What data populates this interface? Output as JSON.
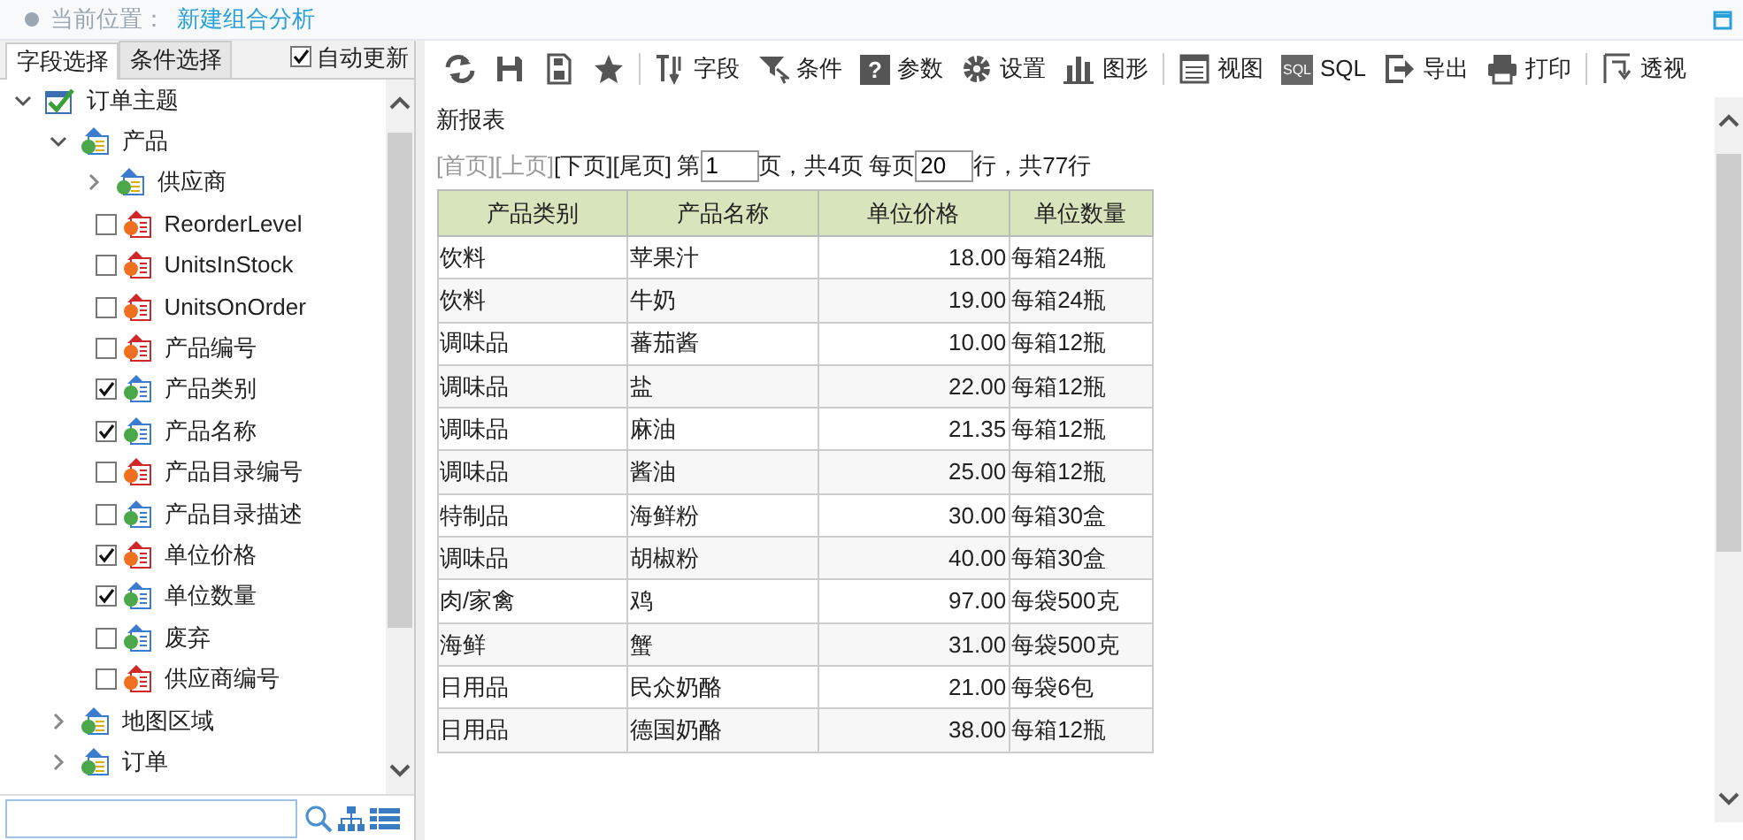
{
  "breadcrumb": {
    "label": "当前位置：",
    "current": "新建组合分析"
  },
  "left_tabs": [
    {
      "label": "字段选择",
      "selected": true
    },
    {
      "label": "条件选择",
      "selected": false
    }
  ],
  "auto_update": {
    "label": "自动更新",
    "checked": true
  },
  "tree": [
    {
      "label": "订单主题",
      "kind": "root",
      "expanded": true,
      "children": [
        {
          "label": "产品",
          "kind": "folder",
          "expanded": true,
          "children": [
            {
              "label": "供应商",
              "kind": "folder",
              "expanded": false
            },
            {
              "label": "ReorderLevel",
              "kind": "measure",
              "checked": false
            },
            {
              "label": "UnitsInStock",
              "kind": "measure",
              "checked": false
            },
            {
              "label": "UnitsOnOrder",
              "kind": "measure",
              "checked": false
            },
            {
              "label": "产品编号",
              "kind": "measure",
              "checked": false
            },
            {
              "label": "产品类别",
              "kind": "dimension",
              "checked": true
            },
            {
              "label": "产品名称",
              "kind": "dimension",
              "checked": true
            },
            {
              "label": "产品目录编号",
              "kind": "measure",
              "checked": false
            },
            {
              "label": "产品目录描述",
              "kind": "dimension",
              "checked": false
            },
            {
              "label": "单位价格",
              "kind": "measure",
              "checked": true
            },
            {
              "label": "单位数量",
              "kind": "dimension",
              "checked": true
            },
            {
              "label": "废弃",
              "kind": "dimension",
              "checked": false
            },
            {
              "label": "供应商编号",
              "kind": "measure",
              "checked": false
            }
          ]
        },
        {
          "label": "地图区域",
          "kind": "folder",
          "expanded": false
        },
        {
          "label": "订单",
          "kind": "folder",
          "expanded": false
        }
      ]
    }
  ],
  "toolbar": [
    [
      {
        "kind": "icon"
      },
      {
        "kind": "icon"
      },
      {
        "kind": "icon"
      },
      {
        "kind": "icon"
      }
    ],
    [
      {
        "kind": "labeled",
        "label": "字段"
      },
      {
        "kind": "labeled",
        "label": "条件"
      },
      {
        "kind": "labeled",
        "label": "参数",
        "glyph": "?"
      },
      {
        "kind": "labeled",
        "label": "设置"
      },
      {
        "kind": "labeled",
        "label": "图形"
      }
    ],
    [
      {
        "kind": "labeled",
        "label": "视图"
      },
      {
        "kind": "labeled",
        "label": "SQL",
        "glyph": "SQL"
      },
      {
        "kind": "labeled",
        "label": "导出"
      },
      {
        "kind": "labeled",
        "label": "打印"
      }
    ],
    [
      {
        "kind": "labeled",
        "label": "透视"
      }
    ]
  ],
  "report": {
    "title": "新报表",
    "pager": {
      "links": [
        {
          "label": "[首页]",
          "disabled": true
        },
        {
          "label": "[上页]",
          "disabled": true
        },
        {
          "label": "[下页]",
          "disabled": false
        },
        {
          "label": "[尾页]",
          "disabled": false
        }
      ],
      "page_prefix": "第",
      "page": "1",
      "page_suffix": "页，共4页",
      "rows_prefix": "每页",
      "rows": "20",
      "rows_suffix": "行，共77行"
    },
    "columns": [
      "产品类别",
      "产品名称",
      "单位价格",
      "单位数量"
    ],
    "rows": [
      [
        "饮料",
        "苹果汁",
        "18.00",
        "每箱24瓶"
      ],
      [
        "饮料",
        "牛奶",
        "19.00",
        "每箱24瓶"
      ],
      [
        "调味品",
        "蕃茄酱",
        "10.00",
        "每箱12瓶"
      ],
      [
        "调味品",
        "盐",
        "22.00",
        "每箱12瓶"
      ],
      [
        "调味品",
        "麻油",
        "21.35",
        "每箱12瓶"
      ],
      [
        "调味品",
        "酱油",
        "25.00",
        "每箱12瓶"
      ],
      [
        "特制品",
        "海鲜粉",
        "30.00",
        "每箱30盒"
      ],
      [
        "调味品",
        "胡椒粉",
        "40.00",
        "每箱30盒"
      ],
      [
        "肉/家禽",
        "鸡",
        "97.00",
        "每袋500克"
      ],
      [
        "海鲜",
        "蟹",
        "31.00",
        "每袋500克"
      ],
      [
        "日用品",
        "民众奶酪",
        "21.00",
        "每袋6包"
      ],
      [
        "日用品",
        "德国奶酪",
        "38.00",
        "每箱12瓶"
      ]
    ]
  }
}
